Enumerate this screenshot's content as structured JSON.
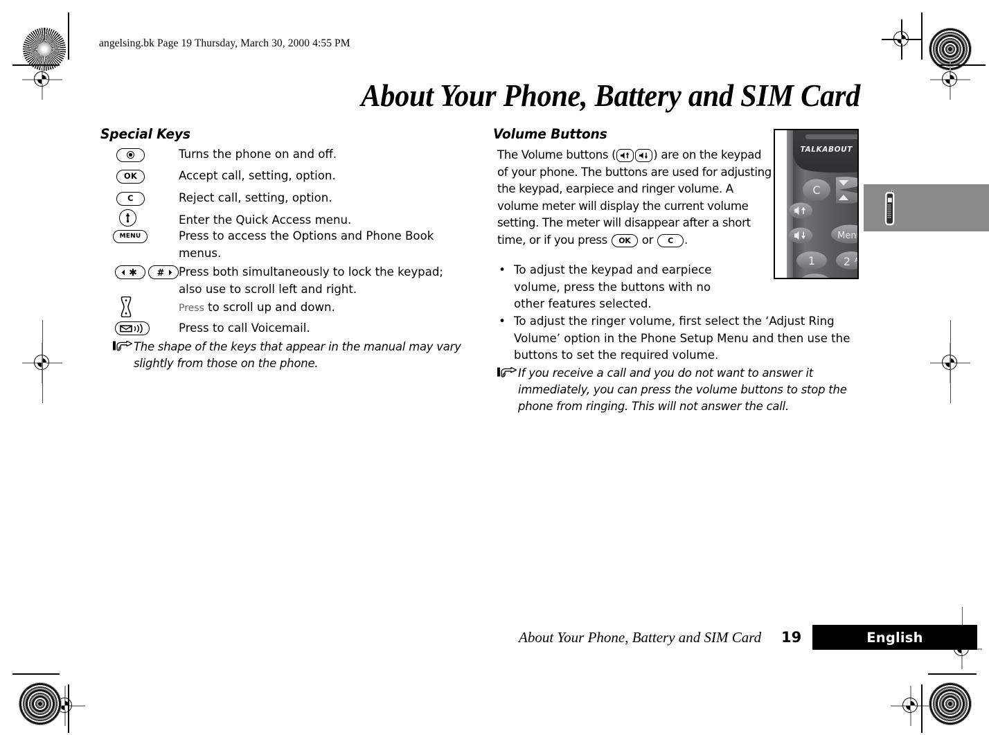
{
  "print_header": "angelsing.bk  Page 19  Thursday, March 30, 2000  4:55 PM",
  "chapter_title": "About Your Phone, Battery and SIM Card",
  "left_column": {
    "heading": "Special Keys",
    "rows": [
      {
        "key_label": "power-key",
        "key_text": "",
        "desc": "Turns the phone on and off."
      },
      {
        "key_label": "ok-key",
        "key_text": "OK",
        "desc": "Accept call, setting, option."
      },
      {
        "key_label": "clear-key",
        "key_text": "C",
        "desc": "Reject call, setting, option."
      },
      {
        "key_label": "quick-access-key",
        "key_text": "",
        "desc": "Enter the Quick Access menu."
      },
      {
        "key_label": "menu-key",
        "key_text": "MENU",
        "desc": "Press to access the Options and Phone Book menus."
      },
      {
        "key_label": "star-hash-keys",
        "key_text": "∗  #",
        "desc": "Press both simultaneously to lock the keypad; also use to scroll left and right."
      },
      {
        "key_label": "scroll-key",
        "key_text": "",
        "desc_small": "Press",
        "desc": " to scroll up and down."
      },
      {
        "key_label": "voicemail-key",
        "key_text": "",
        "desc": "Press to call Voicemail."
      }
    ],
    "note": "The shape of the keys that appear in the manual may vary slightly from those on the phone."
  },
  "right_column": {
    "heading": "Volume Buttons",
    "paragraph_part1": "The Volume buttons (",
    "paragraph_part2": ") are on the keypad of your phone. The buttons are used for adjusting the keypad, earpiece and ringer volume. A volume meter will display the current volume setting. The meter will disappear after a short time, or if you press ",
    "paragraph_or": " or ",
    "paragraph_end": ".",
    "ok_key_text": "OK",
    "clear_key_text": "C",
    "bullet_marker": "•",
    "bullets": [
      "To adjust the keypad and earpiece volume, press the buttons with no other features selected.",
      "To adjust the ringer volume, first select the ‘Adjust Ring Volume’ option in the Phone Setup Menu and then use the buttons to set the required volume."
    ],
    "note": "If you receive a call and you do not want to answer it immediately, you can press the volume buttons to stop the phone from ringing. This will not answer the call."
  },
  "phone_photo": {
    "brand_text": "TALKABOUT",
    "keys": [
      {
        "label": "C"
      },
      {
        "label": "Menu"
      },
      {
        "label": "1"
      },
      {
        "label": "2"
      },
      {
        "label": "ABC"
      }
    ],
    "volume_up_icon": "speaker-up-icon",
    "volume_down_icon": "speaker-down-icon",
    "nav_icon": "up-down-arrow-key"
  },
  "footer": {
    "title": "About Your Phone, Battery and SIM Card",
    "page_number": "19",
    "language": "English"
  },
  "colors": {
    "ink": "#000000",
    "gray_tab": "#8a8a8a",
    "phone_body": "#57585a",
    "phone_dark": "#3a3b3d",
    "phone_key": "#8e9093"
  }
}
